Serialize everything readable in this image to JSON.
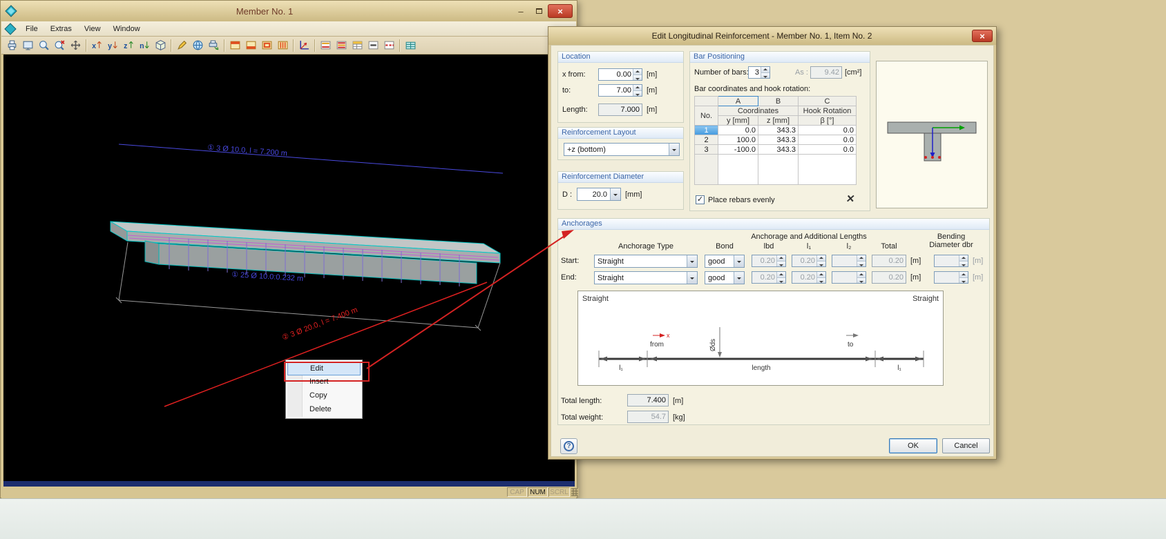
{
  "main_window": {
    "title": "Member No. 1",
    "window_buttons": {
      "minimize": "–",
      "close": "×"
    },
    "menu": {
      "items": [
        "File",
        "Extras",
        "View",
        "Window"
      ]
    },
    "toolbar_icons": [
      "printer",
      "print-preview",
      "zoom-in",
      "zoom-cancel",
      "pan-view",
      "renumber-x",
      "renumber-y",
      "renumber-z",
      "renumber-all",
      "isometric-view",
      "edit-mode",
      "render-globe",
      "print-graphic",
      "section-top-view",
      "section-front-view",
      "section-frame",
      "section-hatch",
      "axes",
      "rebar-layer1",
      "rebar-layer2",
      "rebar-table",
      "rebar-hide",
      "rebar-dash",
      "print-table"
    ],
    "viewport": {
      "annotation_top": "① 3 Ø 10.0, l = 7.200 m",
      "annotation_mid": "① 25 Ø 10.0:0.232 m",
      "annotation_item2": "② 3 Ø 20.0, l = 7.400 m"
    },
    "context_menu": {
      "items": [
        "Edit",
        "Insert",
        "Copy",
        "Delete"
      ]
    },
    "statusbar": {
      "cap": "CAP",
      "num": "NUM",
      "scrl": "SCRL"
    }
  },
  "dialog": {
    "title": "Edit Longitudinal Reinforcement - Member No. 1, Item No. 2",
    "close": "×",
    "location": {
      "legend": "Location",
      "x_from_label": "x from:",
      "x_from_value": "0.00",
      "to_label": "to:",
      "to_value": "7.00",
      "length_label": "Length:",
      "length_value": "7.000",
      "unit_m": "[m]"
    },
    "reinforcement_layout": {
      "legend": "Reinforcement Layout",
      "value": "+z (bottom)"
    },
    "reinforcement_diameter": {
      "legend": "Reinforcement Diameter",
      "label": "D :",
      "value": "20.0",
      "unit": "[mm]"
    },
    "bar_positioning": {
      "legend": "Bar Positioning",
      "number_of_bars_label": "Number of bars:",
      "number_of_bars": "3",
      "as_label": "As :",
      "as_value": "9.42",
      "as_unit": "[cm²]",
      "table_caption": "Bar coordinates and hook rotation:",
      "table": {
        "col_a": "A",
        "col_b": "B",
        "col_c": "C",
        "no": "No.",
        "coordinates": "Coordinates",
        "hook_rotation": "Hook Rotation",
        "y_header": "y [mm]",
        "z_header": "z [mm]",
        "beta_header": "β [°]",
        "rows": [
          {
            "no": "1",
            "y": "0.0",
            "z": "343.3",
            "beta": "0.0"
          },
          {
            "no": "2",
            "y": "100.0",
            "z": "343.3",
            "beta": "0.0"
          },
          {
            "no": "3",
            "y": "-100.0",
            "z": "343.3",
            "beta": "0.0"
          }
        ]
      },
      "place_evenly_label": "Place rebars evenly",
      "place_evenly_checked": true
    },
    "anchorages": {
      "legend": "Anchorages",
      "anchorage_type_header": "Anchorage Type",
      "bond_header": "Bond",
      "lengths_header": "Anchorage and Additional Lengths",
      "lbd_header": "lbd",
      "l1_header": "l₁",
      "l2_header": "l₂",
      "total_header": "Total",
      "bending_header_1": "Bending",
      "bending_header_2": "Diameter dbr",
      "start_label": "Start:",
      "end_label": "End:",
      "start": {
        "type": "Straight",
        "bond": "good",
        "lbd": "0.20",
        "l1": "0.20",
        "l2": "",
        "total": "0.20"
      },
      "end": {
        "type": "Straight",
        "bond": "good",
        "lbd": "0.20",
        "l1": "0.20",
        "l2": "",
        "total": "0.20"
      },
      "unit_m": "[m]",
      "diagram": {
        "left_label": "Straight",
        "right_label": "Straight",
        "from": "from",
        "to": "to",
        "x_marker": "x",
        "ds": "Øds",
        "length": "length",
        "l1": "l₁"
      }
    },
    "totals": {
      "length_label": "Total length:",
      "length_value": "7.400",
      "length_unit": "[m]",
      "weight_label": "Total weight:",
      "weight_value": "54.7",
      "weight_unit": "[kg]"
    },
    "buttons": {
      "ok": "OK",
      "cancel": "Cancel",
      "help": "?"
    }
  }
}
